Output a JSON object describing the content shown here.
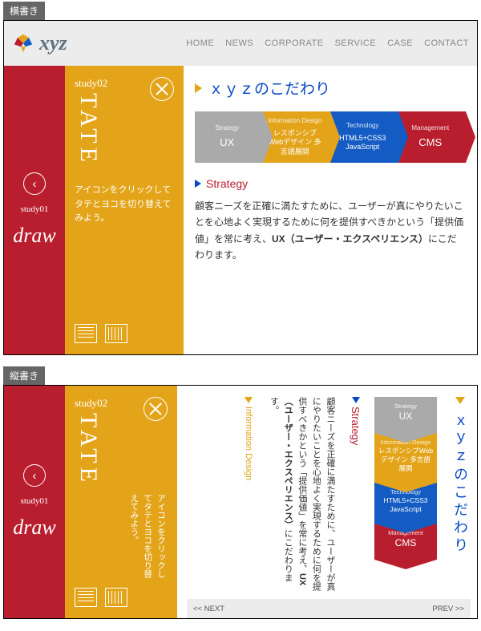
{
  "labels": {
    "horizontal": "横書き",
    "vertical": "縦書き"
  },
  "header": {
    "brand": "xyz",
    "nav": [
      "HOME",
      "NEWS",
      "CORPORATE",
      "SERVICE",
      "CASE",
      "CONTACT"
    ]
  },
  "sidebar": {
    "study1": "study01",
    "draw": "draw",
    "study2": "study02",
    "tate": "TATE",
    "desc": "アイコンをクリックしてタテとヨコを切り替えてみよう。"
  },
  "main": {
    "title": "ｘｙｚのこだわり",
    "chevrons": [
      {
        "top": "Strategy",
        "big": "UX",
        "lines": ""
      },
      {
        "top": "Information Design",
        "big": "",
        "lines": "レスポンシブWebデザイン 多言語展開"
      },
      {
        "top": "Technology",
        "big": "",
        "lines": "HTML5+CSS3 JavaScript"
      },
      {
        "top": "Management",
        "big": "CMS",
        "lines": ""
      }
    ],
    "section_title": "Strategy",
    "body_pre": "顧客ニーズを正確に満たすために、ユーザーが真にやりたいことを心地よく実現するために何を提供すべきかという「提供価値」を常に考え、",
    "body_bold": "UX（ユーザー・エクスペリエンス）",
    "body_post": "にこだわります。",
    "extra_section": "Information Design",
    "pager": {
      "next": "<< NEXT",
      "prev": "PREV >>"
    }
  }
}
